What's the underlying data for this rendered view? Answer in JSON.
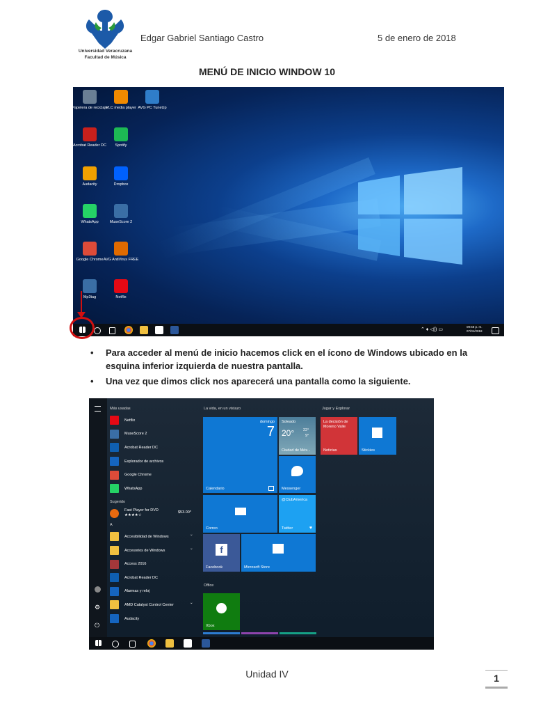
{
  "header": {
    "logo_line1": "Universidad Veracruzana",
    "logo_line2": "Facultad de Música",
    "author": "Edgar Gabriel Santiago Castro",
    "date": "5 de enero de 2018"
  },
  "title": "MENÚ DE INICIO WINDOW 10",
  "desktop": {
    "icons": [
      {
        "label": "Papelera de reciclaje",
        "color": "#6a7f95"
      },
      {
        "label": "VLC media player",
        "color": "#f08a00"
      },
      {
        "label": "AVG PC TuneUp",
        "color": "#2f7dc9"
      },
      {
        "label": "Acrobat Reader DC",
        "color": "#c8201c"
      },
      {
        "label": "Spotify",
        "color": "#1db954"
      },
      {
        "label": "Audacity",
        "color": "#f0a000"
      },
      {
        "label": "Dropbox",
        "color": "#0061fe"
      },
      {
        "label": "WhatsApp",
        "color": "#25d366"
      },
      {
        "label": "MuseScore 2",
        "color": "#3a6ea5"
      },
      {
        "label": "Google Chrome",
        "color": "#dd4b39"
      },
      {
        "label": "AVG AntiVirus FREE",
        "color": "#e06a00"
      },
      {
        "label": "Mp3tag",
        "color": "#3a6ea5"
      },
      {
        "label": "Netflix",
        "color": "#e50914"
      }
    ],
    "clock_time": "09:58 p. m.",
    "clock_date": "07/01/2018"
  },
  "bullets": [
    "Para acceder al menú de inicio hacemos click en el ícono de Windows ubicado en la esquina inferior izquierda de nuestra pantalla.",
    "Una vez que dimos click nos aparecerá una pantalla como la siguiente."
  ],
  "start_menu": {
    "most_used_header": "Más usadas",
    "most_used": [
      {
        "label": "Netflix",
        "color": "#e50914"
      },
      {
        "label": "MuseScore 2",
        "color": "#3a6ea5"
      },
      {
        "label": "Acrobat Reader DC",
        "color": "#0f5fb0"
      },
      {
        "label": "Explorador de archivos",
        "color": "#1565c0"
      },
      {
        "label": "Google Chrome",
        "color": "#dd4b39"
      },
      {
        "label": "WhatsApp",
        "color": "#25d366"
      }
    ],
    "suggested_header": "Sugerido",
    "suggested_app": "Fast Player for DVD",
    "suggested_price": "$53.00*",
    "suggested_rating": "★★★★☆",
    "letter_header": "A",
    "apps_a": [
      {
        "label": "Accesibilidad de Windows",
        "color": "#f0c040",
        "chevron": "⌄"
      },
      {
        "label": "Accesorios de Windows",
        "color": "#f0c040",
        "chevron": "⌄"
      },
      {
        "label": "Access 2016",
        "color": "#a4373a",
        "chevron": ""
      },
      {
        "label": "Acrobat Reader DC",
        "color": "#0f5fb0",
        "chevron": ""
      },
      {
        "label": "Alarmas y reloj",
        "color": "#1565c0",
        "chevron": ""
      },
      {
        "label": "AMD Catalyst Control Center",
        "color": "#f0c040",
        "chevron": "⌄"
      },
      {
        "label": "Audacity",
        "color": "#1565c0",
        "chevron": ""
      }
    ],
    "section_life": "La vida, en un vistazo",
    "section_play": "Jugar y Explorar",
    "section_office": "Office",
    "tiles": {
      "calendar_label": "Calendario",
      "calendar_day": "domingo",
      "calendar_num": "7",
      "weather_header": "Soleado",
      "weather_temp": "20°",
      "weather_high": "22°",
      "weather_low": "9°",
      "weather_city": "Ciudad de Méx...",
      "messenger_label": "Messenger",
      "mail_label": "Correo",
      "twitter_handle": "@ClubAmerica",
      "twitter_label": "Twitter",
      "facebook_label": "Facebook",
      "store_label": "Microsoft Store",
      "news_text": "La decisión de Moreno Valle",
      "news_label": "Noticias",
      "stickies_label": "Stickies",
      "xbox_label": "Xbox"
    }
  },
  "footer": {
    "unit": "Unidad IV",
    "page": "1"
  }
}
